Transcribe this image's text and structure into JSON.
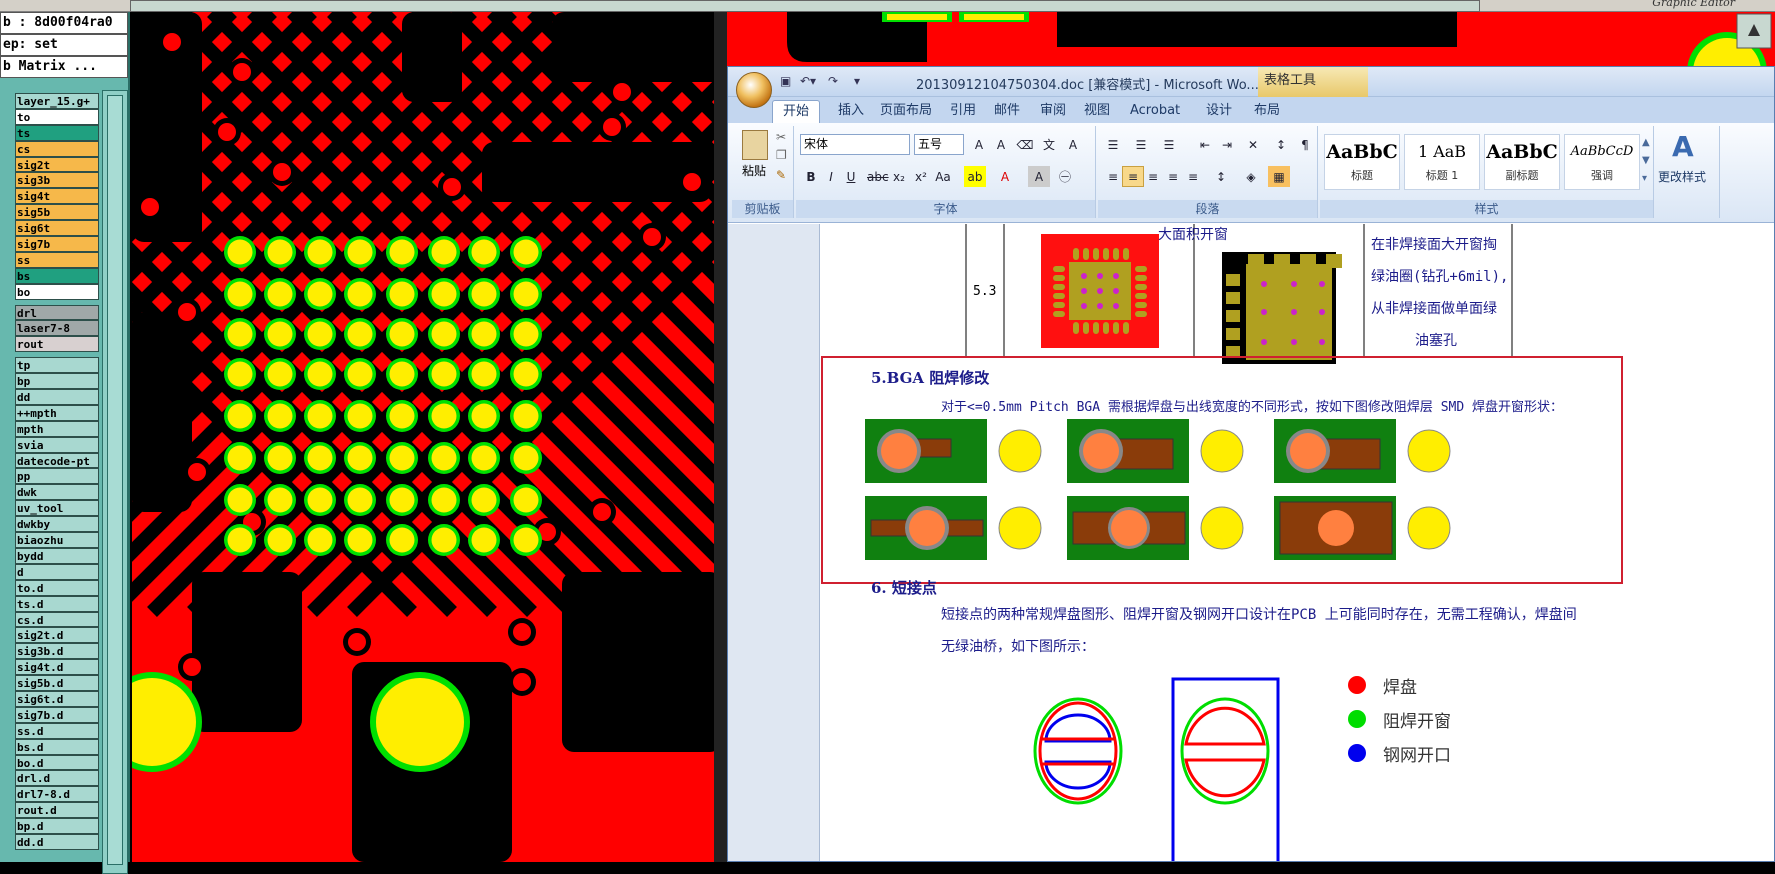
{
  "editor": {
    "job_line": "b : 8d00f04ra0",
    "step_line": "ep: set",
    "matrix_button": "b Matrix ...",
    "title_right": "Graphic Editor"
  },
  "layers": [
    {
      "name": "layer_15.g+",
      "bg": "#a8d8d0"
    },
    {
      "name": "to",
      "bg": "#ffffff"
    },
    {
      "name": "ts",
      "bg": "#20a080"
    },
    {
      "name": "cs",
      "bg": "#f6b84a"
    },
    {
      "name": "sig2t",
      "bg": "#f6b84a"
    },
    {
      "name": "sig3b",
      "bg": "#f6b84a"
    },
    {
      "name": "sig4t",
      "bg": "#f6b84a"
    },
    {
      "name": "sig5b",
      "bg": "#f6b84a"
    },
    {
      "name": "sig6t",
      "bg": "#f6b84a"
    },
    {
      "name": "sig7b",
      "bg": "#f6b84a"
    },
    {
      "name": "ss",
      "bg": "#f6b84a"
    },
    {
      "name": "bs",
      "bg": "#20a080"
    },
    {
      "name": "bo",
      "bg": "#ffffff"
    },
    {
      "name": "drl",
      "bg": "#a0a8a8"
    },
    {
      "name": "laser7-8",
      "bg": "#a0a8a8"
    },
    {
      "name": "rout",
      "bg": "#d8d0d0"
    },
    {
      "name": "tp",
      "bg": "#a8d8d0"
    },
    {
      "name": "bp",
      "bg": "#a8d8d0"
    },
    {
      "name": "dd",
      "bg": "#a8d8d0"
    },
    {
      "name": "++mpth",
      "bg": "#a8d8d0"
    },
    {
      "name": "mpth",
      "bg": "#a8d8d0"
    },
    {
      "name": "svia",
      "bg": "#a8d8d0"
    },
    {
      "name": "datecode-pt",
      "bg": "#a8d8d0"
    },
    {
      "name": "pp",
      "bg": "#a8d8d0"
    },
    {
      "name": "dwk",
      "bg": "#a8d8d0"
    },
    {
      "name": "uv_tool",
      "bg": "#a8d8d0"
    },
    {
      "name": "dwkby",
      "bg": "#a8d8d0"
    },
    {
      "name": "biaozhu",
      "bg": "#a8d8d0"
    },
    {
      "name": "bydd",
      "bg": "#a8d8d0"
    },
    {
      "name": "d",
      "bg": "#a8d8d0"
    },
    {
      "name": "to.d",
      "bg": "#a8d8d0"
    },
    {
      "name": "ts.d",
      "bg": "#a8d8d0"
    },
    {
      "name": "cs.d",
      "bg": "#a8d8d0"
    },
    {
      "name": "sig2t.d",
      "bg": "#a8d8d0"
    },
    {
      "name": "sig3b.d",
      "bg": "#a8d8d0"
    },
    {
      "name": "sig4t.d",
      "bg": "#a8d8d0"
    },
    {
      "name": "sig5b.d",
      "bg": "#a8d8d0"
    },
    {
      "name": "sig6t.d",
      "bg": "#a8d8d0"
    },
    {
      "name": "sig7b.d",
      "bg": "#a8d8d0"
    },
    {
      "name": "ss.d",
      "bg": "#a8d8d0"
    },
    {
      "name": "bs.d",
      "bg": "#a8d8d0"
    },
    {
      "name": "bo.d",
      "bg": "#a8d8d0"
    },
    {
      "name": "drl.d",
      "bg": "#a8d8d0"
    },
    {
      "name": "drl7-8.d",
      "bg": "#a8d8d0"
    },
    {
      "name": "rout.d",
      "bg": "#a8d8d0"
    },
    {
      "name": "bp.d",
      "bg": "#a8d8d0"
    },
    {
      "name": "dd.d",
      "bg": "#a8d8d0"
    }
  ],
  "word": {
    "title": "20130912104750304.doc [兼容模式] - Microsoft Wo...",
    "table_tools": "表格工具",
    "tabs": [
      "开始",
      "插入",
      "页面布局",
      "引用",
      "邮件",
      "审阅",
      "视图",
      "Acrobat",
      "设计",
      "布局"
    ],
    "groups": {
      "clipboard": "剪贴板",
      "font": "字体",
      "paragraph": "段落",
      "styles": "样式"
    },
    "paste_label": "粘贴",
    "font_name": "宋体",
    "font_size": "五号",
    "change_styles": "更改样式",
    "styles": [
      {
        "preview": "AaBbC",
        "label": "标题"
      },
      {
        "preview": "1 AaB",
        "label": "标题 1"
      },
      {
        "preview": "AaBbC",
        "label": "副标题"
      },
      {
        "preview": "AaBbCcD",
        "label": "强调"
      }
    ],
    "doc": {
      "cut_top": "大面积开窗",
      "row_no": "5.3",
      "cell_lines": [
        "在非焊接面大开窗掏",
        "绿油圈(钻孔+6mil),",
        "从非焊接面做单面绿",
        "油塞孔"
      ],
      "sec5_title": "5.BGA 阻焊修改",
      "sec5_body": "对于<=0.5mm Pitch BGA 需根据焊盘与出线宽度的不同形式，按如下图修改阻焊层 SMD 焊盘开窗形状：",
      "sec6_title": "6. 短接点",
      "sec6_body1": "短接点的两种常规焊盘图形、阻焊开窗及钢网开口设计在PCB 上可能同时存在，无需工程确认，焊盘间",
      "sec6_body2": "无绿油桥，如下图所示：",
      "legend": [
        {
          "label": "焊盘",
          "color": "#ff0000"
        },
        {
          "label": "阻焊开窗",
          "color": "#00dd00"
        },
        {
          "label": "钢网开口",
          "color": "#0000ee"
        }
      ]
    }
  },
  "colors": {
    "copper": "#ff0000",
    "pad": "#ffee00",
    "ring": "#00e000",
    "board": "#000000"
  }
}
